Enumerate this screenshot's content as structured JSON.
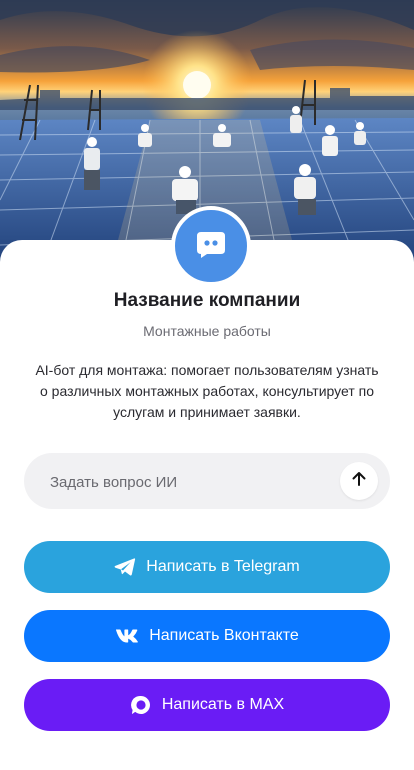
{
  "company": {
    "name": "Название компании",
    "category": "Монтажные работы",
    "description": "AI-бот для монтажа: помогает пользователям узнать о различных монтажных работах, консультирует по услугам и принимает заявки."
  },
  "ask": {
    "placeholder": "Задать вопрос ИИ"
  },
  "buttons": {
    "telegram": "Написать в Telegram",
    "vkontakte": "Написать Вконтакте",
    "max": "Написать в MAX"
  },
  "colors": {
    "avatar": "#4a8fe6",
    "telegram": "#2aa3dd",
    "vkontakte": "#0a77ff",
    "max": "#6a1cf5"
  },
  "icons": {
    "avatar": "chat-bot-icon",
    "send": "arrow-up-icon",
    "telegram": "telegram-icon",
    "vkontakte": "vk-icon",
    "max": "max-icon"
  }
}
